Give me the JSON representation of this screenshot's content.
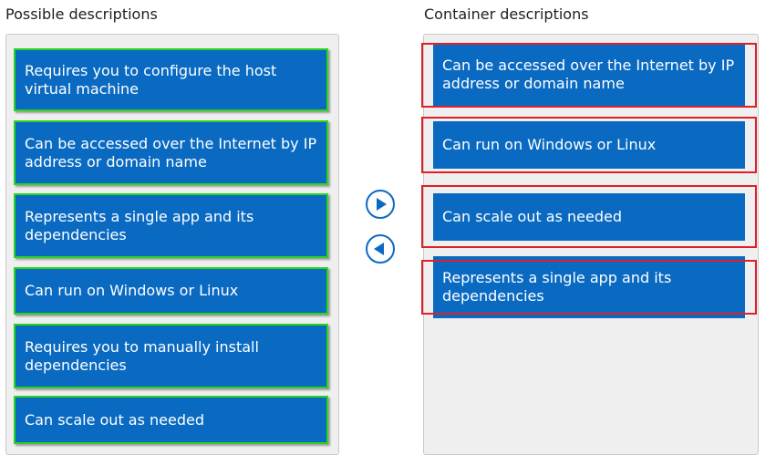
{
  "left": {
    "heading": "Possible descriptions",
    "items": [
      {
        "label": "Requires you to configure the host virtual machine"
      },
      {
        "label": "Can be accessed over the Internet by IP address or domain name"
      },
      {
        "label": "Represents a single app and its dependencies"
      },
      {
        "label": "Can run on Windows or Linux"
      },
      {
        "label": "Requires you to manually install dependencies"
      },
      {
        "label": "Can scale out as needed"
      }
    ]
  },
  "right": {
    "heading": "Container descriptions",
    "items": [
      {
        "label": "Can be accessed over the Internet by IP address or domain name"
      },
      {
        "label": "Can run on Windows or Linux"
      },
      {
        "label": "Can scale out as needed"
      },
      {
        "label": "Represents a single app and its dependencies"
      }
    ]
  },
  "controls": {
    "move_right_icon": "play-right-circle-icon",
    "move_left_icon": "play-left-circle-icon"
  },
  "colors": {
    "tile": "#0a6ac2",
    "selected_outline": "#2ad51f",
    "answer_outline": "#e11f26",
    "panel": "#efefef"
  }
}
